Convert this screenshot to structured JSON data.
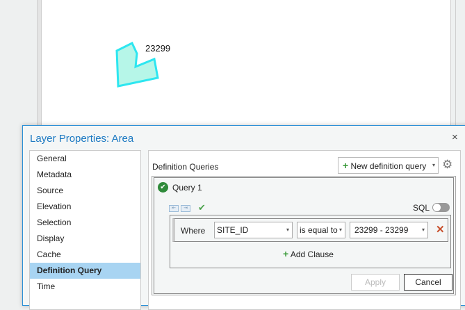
{
  "map": {
    "feature_label": "23299",
    "polygon_fill": "#b6f6e8",
    "polygon_stroke": "#2de6f0"
  },
  "dialog": {
    "title": "Layer Properties: Area",
    "close": "×"
  },
  "nav": [
    "General",
    "Metadata",
    "Source",
    "Elevation",
    "Selection",
    "Display",
    "Cache",
    "Definition Query",
    "Time"
  ],
  "nav_selected": "Definition Query",
  "panel": {
    "heading": "Definition Queries",
    "new_query": "New definition query",
    "query_name": "Query 1",
    "sql_label": "SQL",
    "sql_on": false,
    "clause": {
      "where": "Where",
      "field": "SITE_ID",
      "operator": "is equal to",
      "value": "23299 - 23299"
    },
    "add_clause": "Add Clause",
    "apply": "Apply",
    "cancel": "Cancel"
  }
}
